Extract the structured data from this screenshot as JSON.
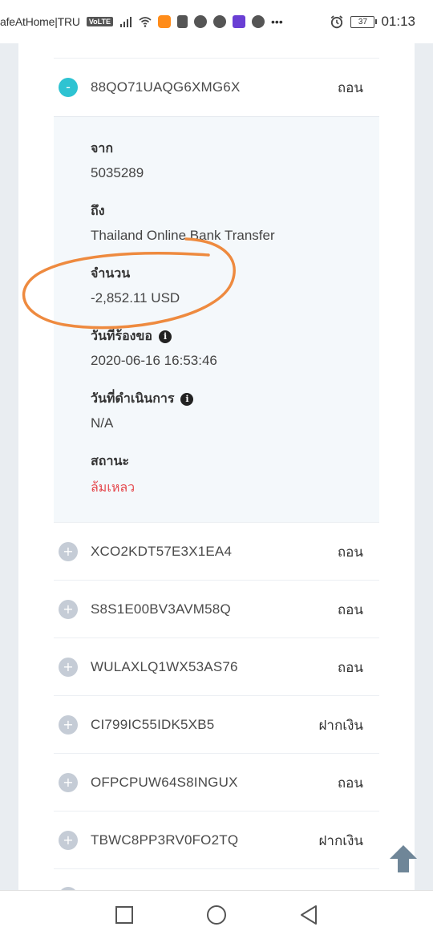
{
  "status_bar": {
    "carrier": "afeAtHome|TRU",
    "network_badge": "VoLTE",
    "battery": "37",
    "time": "01:13"
  },
  "transactions": [
    {
      "id": "88QO71UAQG6XMG6X",
      "type": "ถอน",
      "expanded": true
    },
    {
      "id": "XCO2KDT57E3X1EA4",
      "type": "ถอน",
      "expanded": false
    },
    {
      "id": "S8S1E00BV3AVM58Q",
      "type": "ถอน",
      "expanded": false
    },
    {
      "id": "WULAXLQ1WX53AS76",
      "type": "ถอน",
      "expanded": false
    },
    {
      "id": "CI799IC55IDK5XB5",
      "type": "ฝากเงิน",
      "expanded": false
    },
    {
      "id": "OFPCPUW64S8INGUX",
      "type": "ถอน",
      "expanded": false
    },
    {
      "id": "TBWC8PP3RV0FO2TQ",
      "type": "ฝากเงิน",
      "expanded": false
    }
  ],
  "detail": {
    "from_label": "จาก",
    "from_value": "5035289",
    "to_label": "ถึง",
    "to_value": "Thailand Online Bank Transfer",
    "amount_label": "จำนวน",
    "amount_value": "-2,852.11 USD",
    "requested_label": "วันที่ร้องขอ",
    "requested_value": "2020-06-16 16:53:46",
    "processed_label": "วันที่ดำเนินการ",
    "processed_value": "N/A",
    "status_label": "สถานะ",
    "status_value": "ล้มเหลว"
  },
  "toggle_symbols": {
    "open": "-",
    "closed": "+"
  },
  "colors": {
    "toggle_open": "#2ec3d2",
    "toggle_closed": "#c5ccd6",
    "status_failed": "#e5484d",
    "annotation": "#ee8a3f",
    "scroll_arrow": "#6f8698"
  },
  "icons": [
    "wifi-icon",
    "signal-icon",
    "alarm-icon",
    "info-icon",
    "arrow-up-icon",
    "square-nav-icon",
    "circle-nav-icon",
    "triangle-back-icon"
  ]
}
